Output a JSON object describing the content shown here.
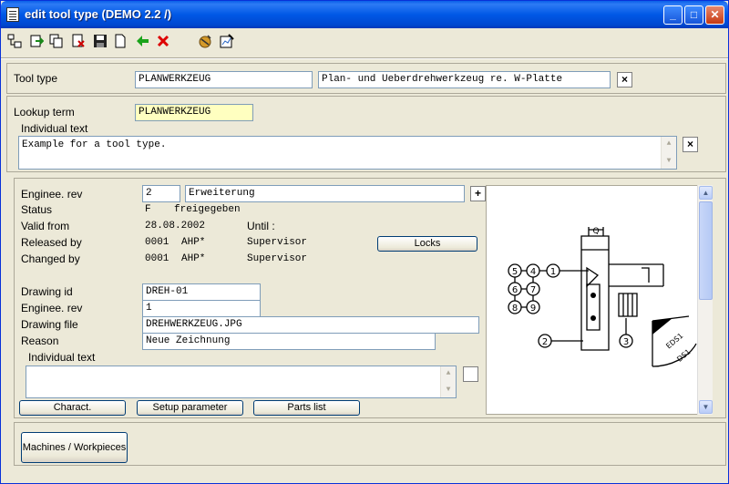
{
  "window": {
    "title": "edit tool type (DEMO 2.2 /)",
    "minimize": "_",
    "maximize": "□",
    "close": "✕"
  },
  "toolbar": {
    "icons": [
      "tree-icon",
      "export-icon",
      "copy-icon",
      "delete-doc-icon",
      "save-icon",
      "new-doc-icon",
      "back-arrow-icon",
      "cancel-icon",
      "globe-icon",
      "edit-chart-icon"
    ]
  },
  "tool_type": {
    "label": "Tool type",
    "code": "PLANWERKZEUG",
    "description": "Plan- und Ueberdrehwerkzeug re. W-Platte",
    "clear": "×"
  },
  "lookup": {
    "label": "Lookup term",
    "value": "PLANWERKZEUG"
  },
  "individual_text": {
    "label": "Individual text",
    "value": "Example for a tool type.",
    "clear": "×"
  },
  "revision": {
    "enginee_rev_label": "Enginee. rev",
    "enginee_rev_value": "2",
    "enginee_rev_desc": "Erweiterung",
    "add": "+",
    "status_label": "Status",
    "status_code": "F",
    "status_text": "freigegeben",
    "valid_from_label": "Valid from",
    "valid_from_value": "28.08.2002",
    "until_label": "Until :",
    "released_by_label": "Released by",
    "released_by_id": "0001",
    "released_by_code": "AHP*",
    "released_by_name": "Supervisor",
    "locks_button": "Locks",
    "changed_by_label": "Changed by",
    "changed_by_id": "0001",
    "changed_by_code": "AHP*",
    "changed_by_name": "Supervisor"
  },
  "drawing": {
    "id_label": "Drawing id",
    "id_value": "DREH-01",
    "rev_label": "Enginee. rev",
    "rev_value": "1",
    "file_label": "Drawing file",
    "file_value": "DREHWERKZEUG.JPG",
    "reason_label": "Reason",
    "reason_value": "Neue Zeichnung",
    "indiv_label": "Individual text",
    "indiv_value": ""
  },
  "buttons": {
    "charact": "Charact.",
    "setup": "Setup parameter",
    "parts": "Parts list",
    "machines": "Machines / Workpieces"
  },
  "drawing_image": {
    "numbers": [
      "5",
      "4",
      "1",
      "6",
      "7",
      "8",
      "9",
      "2",
      "3"
    ],
    "label_a": "EDS1",
    "label_b": "DS1",
    "label_q": "Q"
  }
}
